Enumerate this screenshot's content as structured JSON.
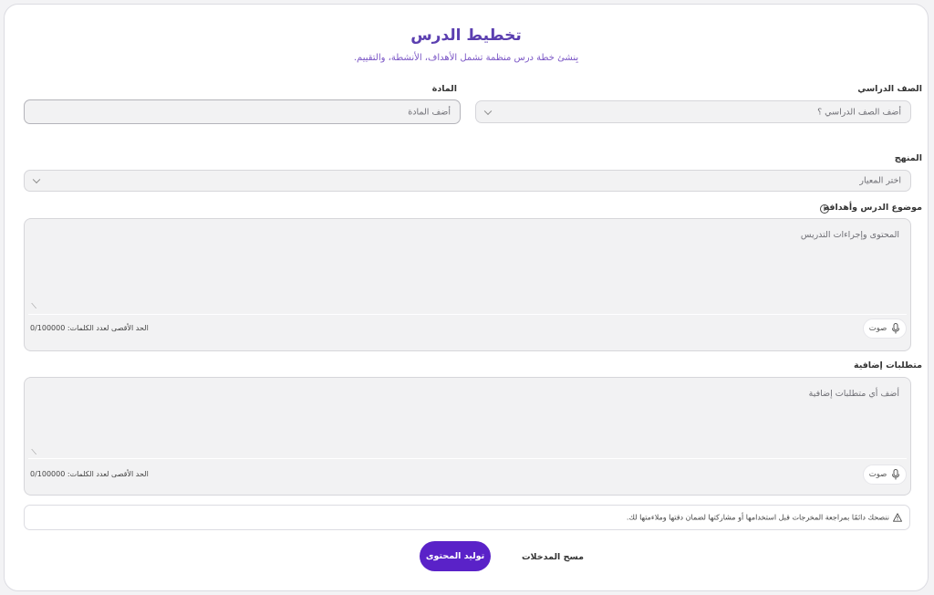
{
  "header": {
    "title": "تخطيط الدرس",
    "subtitle": "بِنشئ خطة درس منظمة تشمل الأهداف، الأنشطة، والتقييم."
  },
  "grade": {
    "label": "الصف الدراسي",
    "placeholder": "أضف الصف الدراسي ؟"
  },
  "subject": {
    "label": "المادة",
    "placeholder": "أضف المادة"
  },
  "curriculum": {
    "label": "المنهج",
    "placeholder": "اختر المعيار"
  },
  "topic": {
    "label": "موضوع الدرس وأهدافه",
    "placeholder": "المحتوى وإجراءات التدريس",
    "limit": "الحد الأقصى لعدد الكلمات: 0/100000",
    "voice_label": "صوت"
  },
  "extra": {
    "label": "متطلبات إضافية",
    "placeholder": "أضف أي متطلبات إضافية",
    "limit": "الحد الأقصى لعدد الكلمات: 0/100000",
    "voice_label": "صوت"
  },
  "notice": {
    "text": "ننصحك دائمًا بمراجعة المخرجات قبل استخدامها أو مشاركتها لضمان دقتها وملاءمتها لك."
  },
  "actions": {
    "generate_label": "توليد المحتوى",
    "clear_label": "مسح المدخلات"
  },
  "colors": {
    "accent": "#5a22c8",
    "title": "#5b3fb0"
  }
}
